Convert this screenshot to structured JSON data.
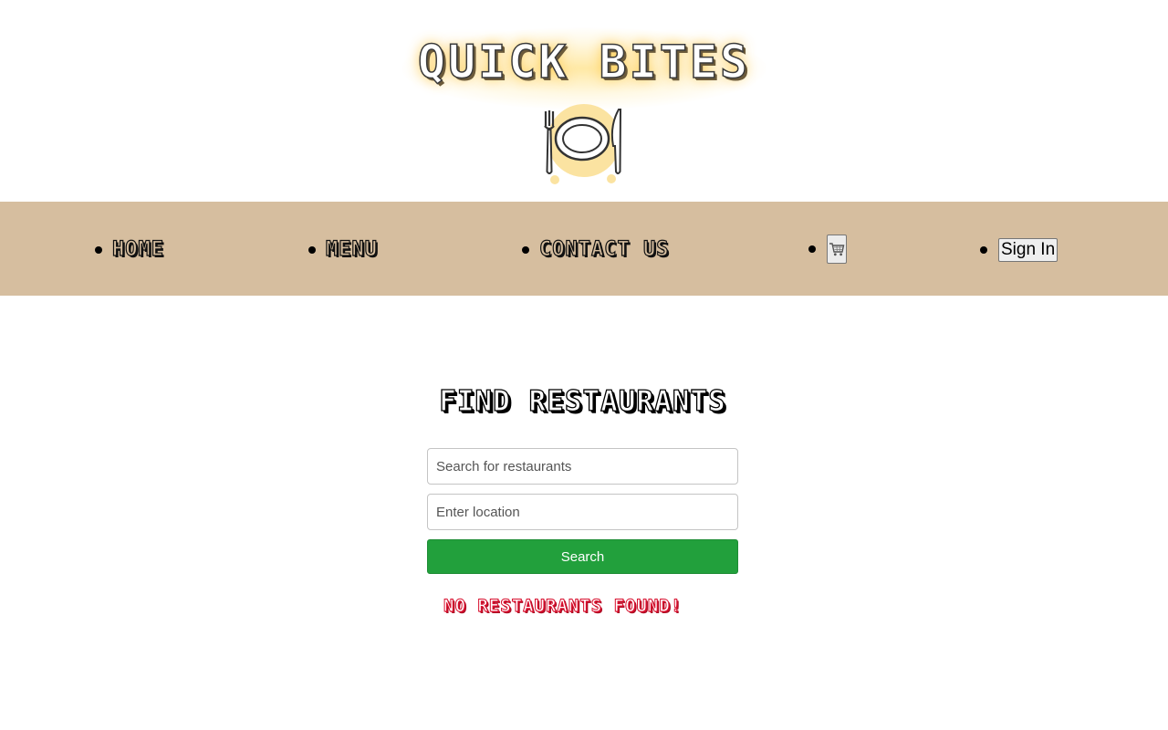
{
  "header": {
    "site_title": "QUICK BITES",
    "logo_icon": "plate-fork-knife-icon"
  },
  "nav": {
    "items": [
      {
        "label": "HOME"
      },
      {
        "label": "MENU"
      },
      {
        "label": "CONTACT US"
      }
    ],
    "cart_icon": "shopping-cart-icon",
    "signin_label": "Sign In",
    "background": "#d6be9f"
  },
  "main": {
    "title": "FIND RESTAURANTS",
    "search_placeholder": "Search for restaurants",
    "location_placeholder": "Enter location",
    "search_button_label": "Search",
    "search_button_color": "#22a03c",
    "empty_message": "NO RESTAURANTS FOUND!",
    "empty_message_color": "#d8102e"
  }
}
